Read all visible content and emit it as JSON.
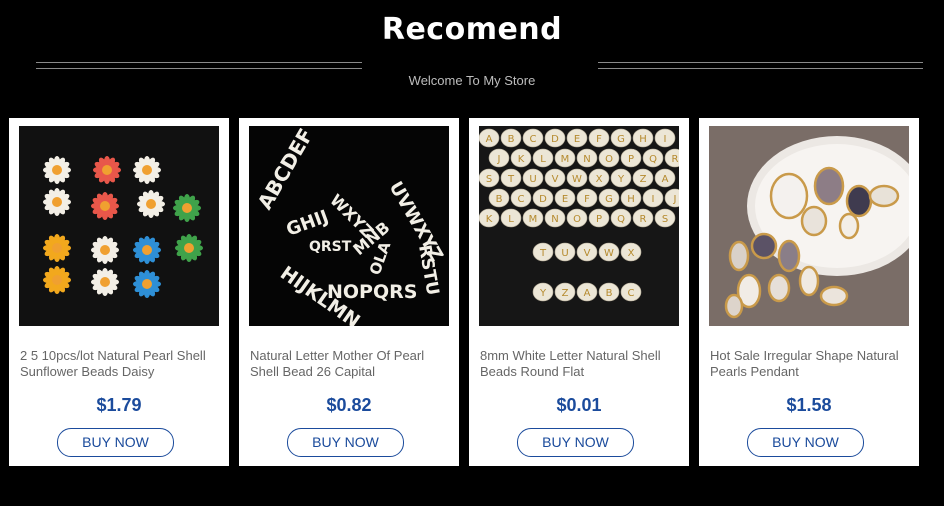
{
  "header": {
    "title": "Recomend",
    "subtitle": "Welcome To My Store"
  },
  "products": [
    {
      "title": "2 5 10pcs/lot Natural Pearl Shell Sunflower Beads Daisy",
      "price": "$1.79",
      "buy_label": "BUY NOW",
      "image_icon": "sunflower-beads-image"
    },
    {
      "title": "Natural Letter Mother Of Pearl Shell Bead 26 Capital",
      "price": "$0.82",
      "buy_label": "BUY NOW",
      "image_icon": "letter-beads-image"
    },
    {
      "title": "8mm White Letter Natural Shell Beads Round Flat",
      "price": "$0.01",
      "buy_label": "BUY NOW",
      "image_icon": "round-letter-beads-image"
    },
    {
      "title": "Hot Sale Irregular Shape Natural Pearls Pendant",
      "price": "$1.58",
      "buy_label": "BUY NOW",
      "image_icon": "pearl-pendant-image"
    }
  ],
  "colors": {
    "background": "#000000",
    "accent": "#1b4b9c",
    "card": "#ffffff"
  }
}
